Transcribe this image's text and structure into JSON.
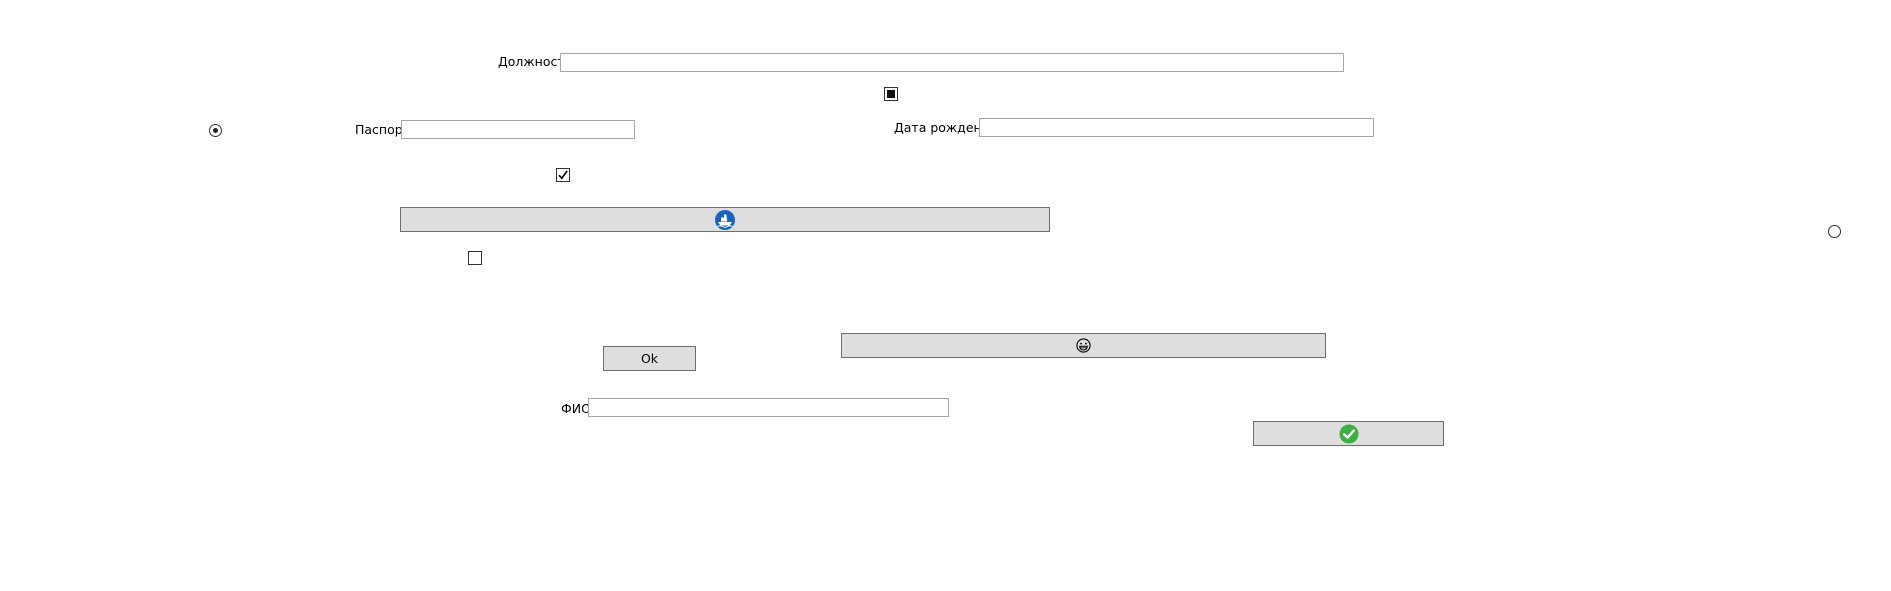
{
  "form": {
    "position_label": "Должность",
    "position_value": "",
    "passport_label": "Паспорт",
    "passport_value": "",
    "birthdate_label": "Дата рождения",
    "birthdate_value": "",
    "fio_label": "ФИО",
    "fio_value": "",
    "ok_button_label": "Ok"
  },
  "controls": {
    "checkbox_top_state": "indeterminate",
    "checkbox_middle_state": "checked",
    "checkbox_bottom_state": "unchecked",
    "radio_left_state": "selected",
    "radio_right_state": "unselected"
  },
  "icons": {
    "wide_button_icon": "ship-icon",
    "emoji_button_icon": "grinning-face-icon",
    "confirm_button_icon": "checkmark-icon"
  },
  "colors": {
    "ship_icon": "#1565c0",
    "confirm_icon": "#3cb043",
    "button_bg": "#dedede"
  }
}
